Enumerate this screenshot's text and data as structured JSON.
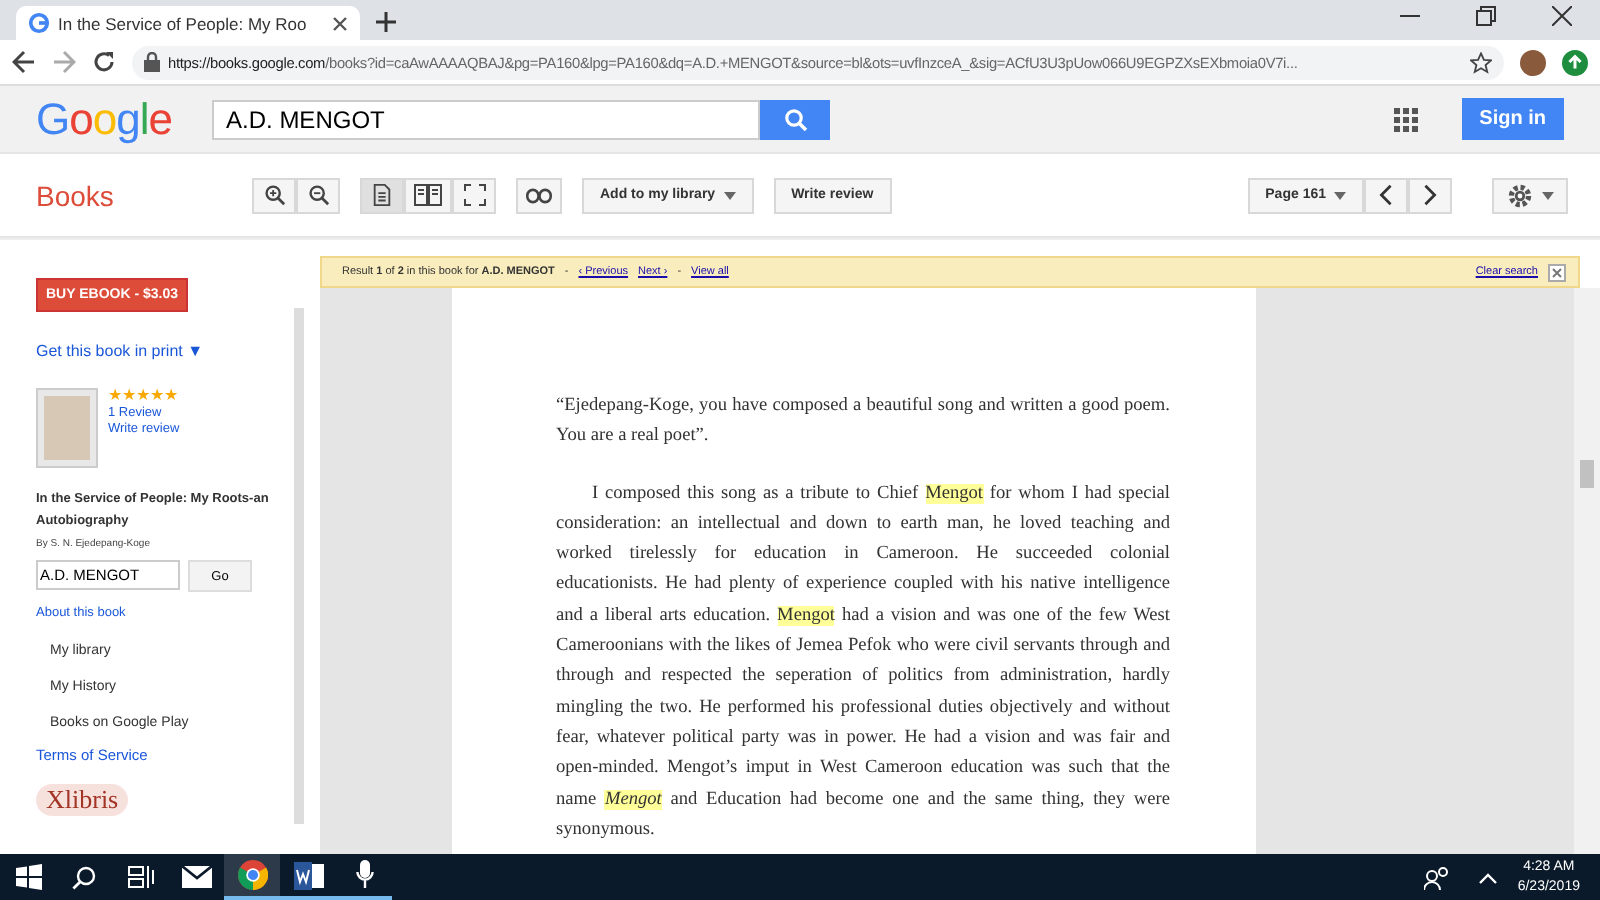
{
  "browser": {
    "tab_title": "In the Service of People: My Roo",
    "url_host": "https://books.google.com",
    "url_path": "/books?id=caAwAAAAQBAJ&pg=PA160&lpg=PA160&dq=A.D.+MENGOT&source=bl&ots=uvfInzceA_&sig=ACfU3U3pUow066U9EGPZXsEXbmoia0V7i..."
  },
  "header": {
    "logo": "Google",
    "search_value": "A.D. MENGOT",
    "sign_in": "Sign in"
  },
  "toolbar": {
    "section": "Books",
    "view_modes": [
      {
        "kind": "single",
        "selected": true
      },
      {
        "kind": "double",
        "selected": false
      },
      {
        "kind": "fullscreen",
        "selected": false
      }
    ],
    "add_to_library": "Add to my library",
    "write_review": "Write review",
    "page": "Page 161"
  },
  "sidebar": {
    "buy_button": "BUY EBOOK - $3.03",
    "print_link": "Get this book in print ▼",
    "stars": 5,
    "reviews": "1 Review",
    "write_review": "Write review",
    "book_title": "In the Service of People: My Roots-an Autobiography",
    "author": "By S. N. Ejedepang-Koge",
    "search_value": "A.D. MENGOT",
    "go": "Go",
    "about": "About this book",
    "nav_items": [
      "My library",
      "My History",
      "Books on Google Play"
    ],
    "terms": "Terms of Service",
    "publisher_logo": "Xlibris"
  },
  "search_bar": {
    "result": "Result **1** of **2** in this book for **A.D. MENGOT**",
    "separator_1": "-",
    "previous": "‹ Previous",
    "next": "Next ›",
    "separator_2": "-",
    "view_all": "View all",
    "clear": "Clear search"
  },
  "page": {
    "paragraphs": [
      {
        "indent": false,
        "segments": [
          {
            "text": "“Ejedepang-Koge, you have composed a beautiful song and written a good poem. You are a real poet”.",
            "highlighted": false
          }
        ]
      },
      {
        "indent": true,
        "segments": [
          {
            "text": "I composed this song as a tribute to Chief ",
            "highlighted": false
          },
          {
            "text": "Mengot",
            "highlighted": true
          },
          {
            "text": " for whom I had special consideration: an intellectual and down to earth man, he loved teaching and worked tirelessly for education in Cameroon. He succeeded colonial educationists. He had plenty of experience coupled with his native intelligence and a liberal arts education. ",
            "highlighted": false
          },
          {
            "text": "Mengot",
            "highlighted": true
          },
          {
            "text": " had a vision and was one of the few West Cameroonians with the likes of Jemea Pefok who were civil servants through and through and respected the seperation of politics from administration, hardly mingling the two. He performed his professional duties objectively and without fear, whatever political party was in power. He had a vision and was fair and open-minded. Mengot’s imput in West Cameroon education was such that the name ",
            "highlighted": false
          },
          {
            "text": "*Mengot*",
            "highlighted": true
          },
          {
            "text": " and Education had become one and the same thing, they were synonymous.",
            "highlighted": false
          }
        ]
      }
    ]
  },
  "taskbar": {
    "apps": [
      {
        "kind": "start",
        "open": false,
        "selected": false
      },
      {
        "kind": "search",
        "open": false,
        "selected": false
      },
      {
        "kind": "taskview",
        "open": false,
        "selected": false
      },
      {
        "kind": "mail",
        "open": false,
        "selected": false
      },
      {
        "kind": "chrome",
        "open": true,
        "selected": true
      },
      {
        "kind": "word",
        "open": true,
        "selected": false
      },
      {
        "kind": "mic",
        "open": true,
        "selected": false
      }
    ],
    "time": "4:28 AM",
    "date": "6/23/2019"
  }
}
